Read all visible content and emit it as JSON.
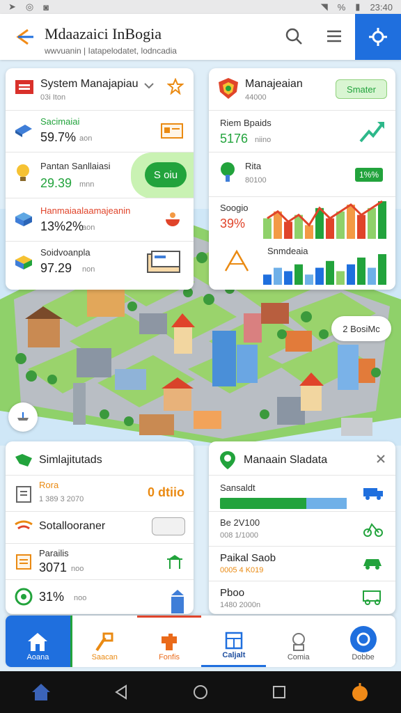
{
  "status_bar": {
    "left_icons": [
      "notification-icon",
      "camera-icon",
      "instagram-icon"
    ],
    "right_text": "%",
    "time": "23:40"
  },
  "header": {
    "title": "Mdaazaici InBogia",
    "subtitle": "wwvuanin | Iatapelodatet, lodncadia"
  },
  "system_card": {
    "title": "System Manajapiau",
    "subtitle": "03i Iton",
    "rows": [
      {
        "label": "Sacimaiai",
        "value": "59.7%",
        "unit": "aon"
      },
      {
        "label": "Pantan Sanllaiasi",
        "value": "29.39",
        "unit": "mnn",
        "button": "S oiu"
      },
      {
        "label": "Hanmaiaalaamajeanin",
        "value": "13%2%",
        "unit": "aon"
      },
      {
        "label": "Soidvoanpla",
        "value": "97.29",
        "unit": "non"
      }
    ]
  },
  "manage_card": {
    "title": "Manajeaian",
    "subtitle": "44000",
    "badge": "Smater",
    "rows": [
      {
        "label": "Riem Bpaids",
        "value": "5176",
        "unit": "niino"
      },
      {
        "label": "Rita",
        "sub": "80100",
        "badge": "1%%"
      },
      {
        "label": "Soogio",
        "value": "39%"
      },
      {
        "label": "Snmdeaia"
      }
    ]
  },
  "map_badge": "2 BosiMc",
  "sim_card": {
    "title": "Simlajitutads",
    "rows": [
      {
        "label": "Rora",
        "sub": "1 389 3 2070",
        "value": "0 dtiio"
      },
      {
        "label": "Sotallooraner"
      },
      {
        "label": "Parailis",
        "value": "3071",
        "unit": "noo"
      },
      {
        "label": "",
        "value": "31%",
        "unit": "noo"
      }
    ]
  },
  "main_card": {
    "title": "Manaain Sladata",
    "rows": [
      {
        "label": "Sansaldt"
      },
      {
        "label": "Be 2V100",
        "sub": "008 1/1000"
      },
      {
        "label": "Paikal Saob",
        "sub": "0005 4 K019"
      },
      {
        "label": "Pboo",
        "sub": "1480 2000n"
      }
    ]
  },
  "nav": [
    {
      "label": "Aoana"
    },
    {
      "label": "Saacan"
    },
    {
      "label": "Fonfis"
    },
    {
      "label": "Caljalt"
    },
    {
      "label": "Comia"
    },
    {
      "label": "Dobbe"
    }
  ],
  "chart_data": {
    "type": "bar",
    "series": [
      {
        "values": [
          6,
          8,
          5,
          7,
          4,
          9,
          6,
          8,
          10,
          7,
          9,
          11
        ]
      },
      {
        "values": [
          3,
          5,
          4,
          6,
          3,
          5,
          7,
          4,
          6,
          8,
          5,
          9
        ]
      }
    ]
  },
  "colors": {
    "accent_blue": "#1f6fde",
    "green": "#22a33c",
    "orange": "#ea8a12",
    "red": "#e0442a"
  }
}
